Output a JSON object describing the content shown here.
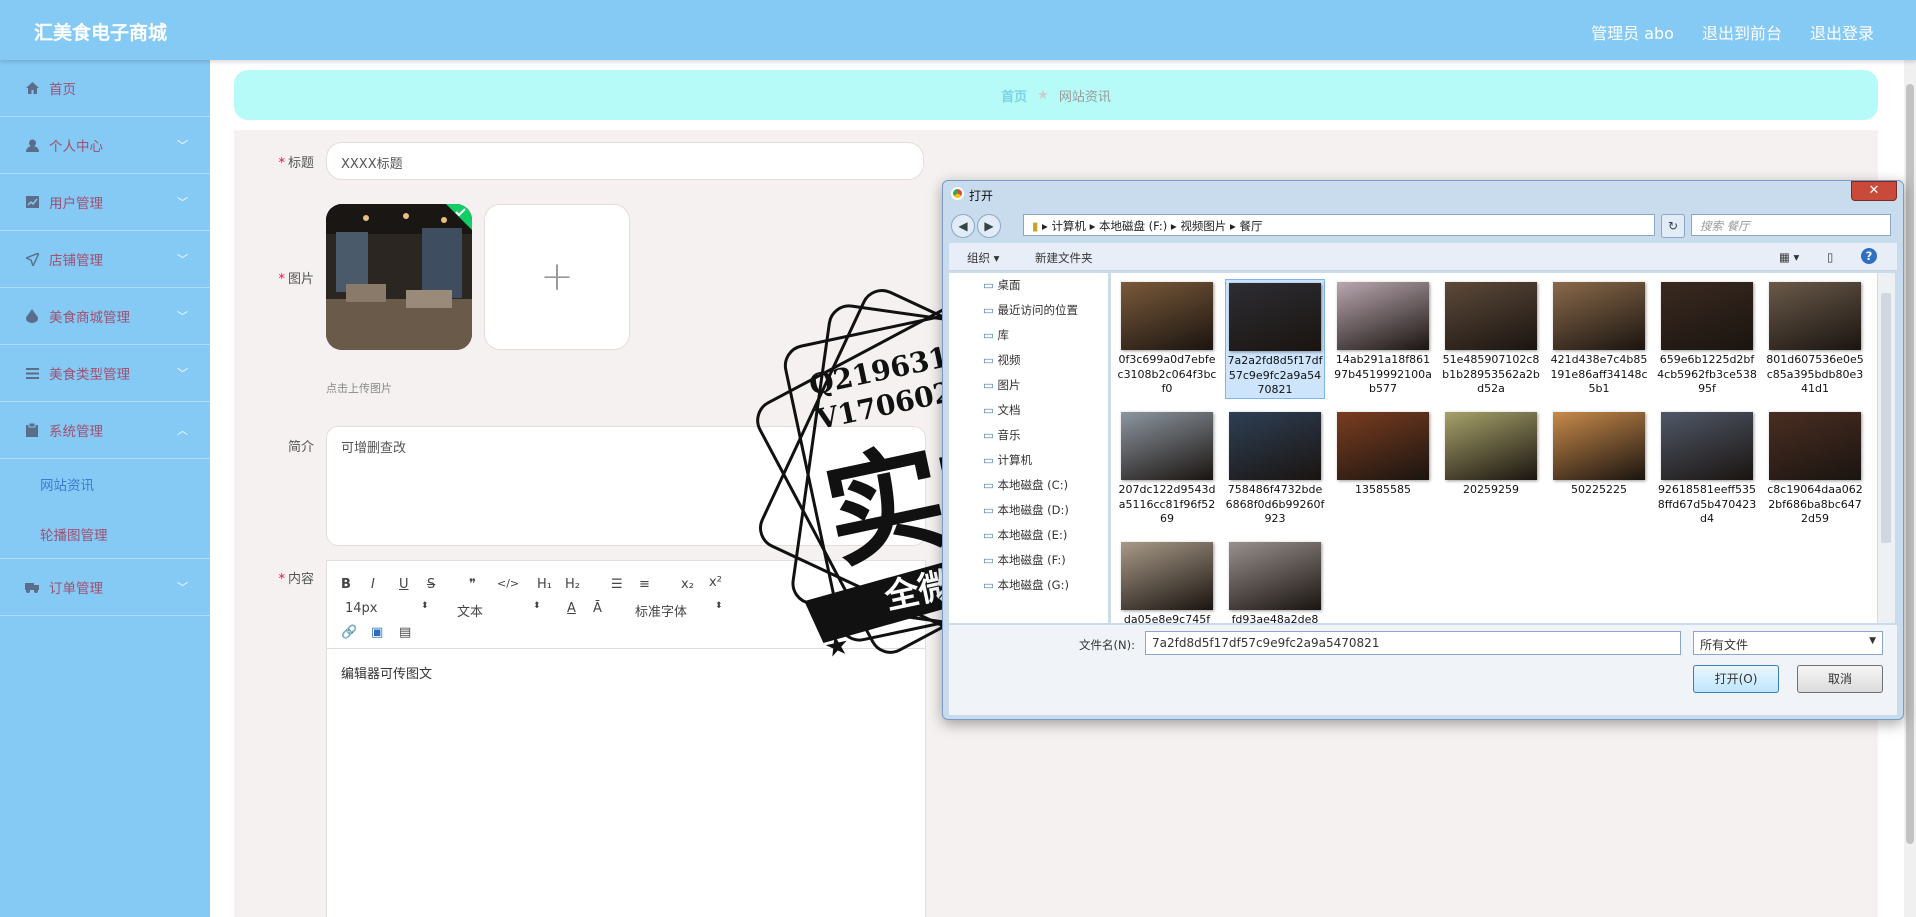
{
  "app": {
    "title": "汇美食电子商城",
    "nav": [
      "管理员 abo",
      "退出到前台",
      "退出登录"
    ]
  },
  "sidebar": {
    "items": [
      {
        "label": "首页",
        "icon": "home-icon"
      },
      {
        "label": "个人中心",
        "icon": "user-icon"
      },
      {
        "label": "用户管理",
        "icon": "chart-icon"
      },
      {
        "label": "店铺管理",
        "icon": "send-icon"
      },
      {
        "label": "美食商城管理",
        "icon": "drop-icon"
      },
      {
        "label": "美食类型管理",
        "icon": "list-icon"
      },
      {
        "label": "系统管理",
        "icon": "clipboard-icon"
      },
      {
        "label": "订单管理",
        "icon": "truck-icon"
      }
    ],
    "sub": [
      "网站资讯",
      "轮播图管理"
    ]
  },
  "breadcrumb": {
    "home": "首页",
    "current": "网站资讯"
  },
  "form": {
    "title_label": "标题",
    "title_value": "XXXX标题",
    "image_label": "图片",
    "upload_hint": "点击上传图片",
    "plus": "+",
    "intro_label": "简介",
    "intro_value": "可增删查改",
    "content_label": "内容",
    "editor_text": "编辑器可传图文",
    "toolbar": {
      "size": "14px",
      "block": "文本",
      "font": "标准字体"
    }
  },
  "dialog": {
    "title": "打开",
    "close": "✕",
    "path": [
      "计算机",
      "本地磁盘 (F:)",
      "视频图片",
      "餐厅"
    ],
    "search_placeholder": "搜索 餐厅",
    "organize": "组织 ▾",
    "new_folder": "新建文件夹",
    "tree": [
      "桌面",
      "最近访问的位置",
      "库",
      "视频",
      "图片",
      "文档",
      "音乐",
      "计算机",
      "本地磁盘 (C:)",
      "本地磁盘 (D:)",
      "本地磁盘 (E:)",
      "本地磁盘 (F:)",
      "本地磁盘 (G:)"
    ],
    "files": [
      "0f3c699a0d7ebfec3108b2c064f3bcf0",
      "7a2a2fd8d5f17df57c9e9fc2a9a5470821",
      "14ab291a18f86197b4519992100ab577",
      "51e485907102c8b1b28953562a2bd52a",
      "421d438e7c4b85191e86aff34148c5b1",
      "659e6b1225d2bf4cb5962fb3ce53895f",
      "801d607536e0e5c85a395bdb80e341d1",
      "207dc122d9543da5116cc81f96f5269",
      "758486f4732bde6868f0d6b99260f923",
      "13585585",
      "20259259",
      "50225225",
      "92618581eeff5358ffd67d5b470423d4",
      "c8c19064daa0622bf686ba8bc6472d59",
      "da05e8e9c745f",
      "fd93ae48a2de8"
    ],
    "filename_label": "文件名(N):",
    "filename_value": "7a2fd8d5f17df57c9e9fc2a9a5470821",
    "filter": "所有文件",
    "open": "打开(O)",
    "cancel": "取消"
  },
  "watermark": {
    "line1": "Q2196316269",
    "line2": "V1706025699",
    "big": "实拍",
    "band": "全微程序"
  }
}
